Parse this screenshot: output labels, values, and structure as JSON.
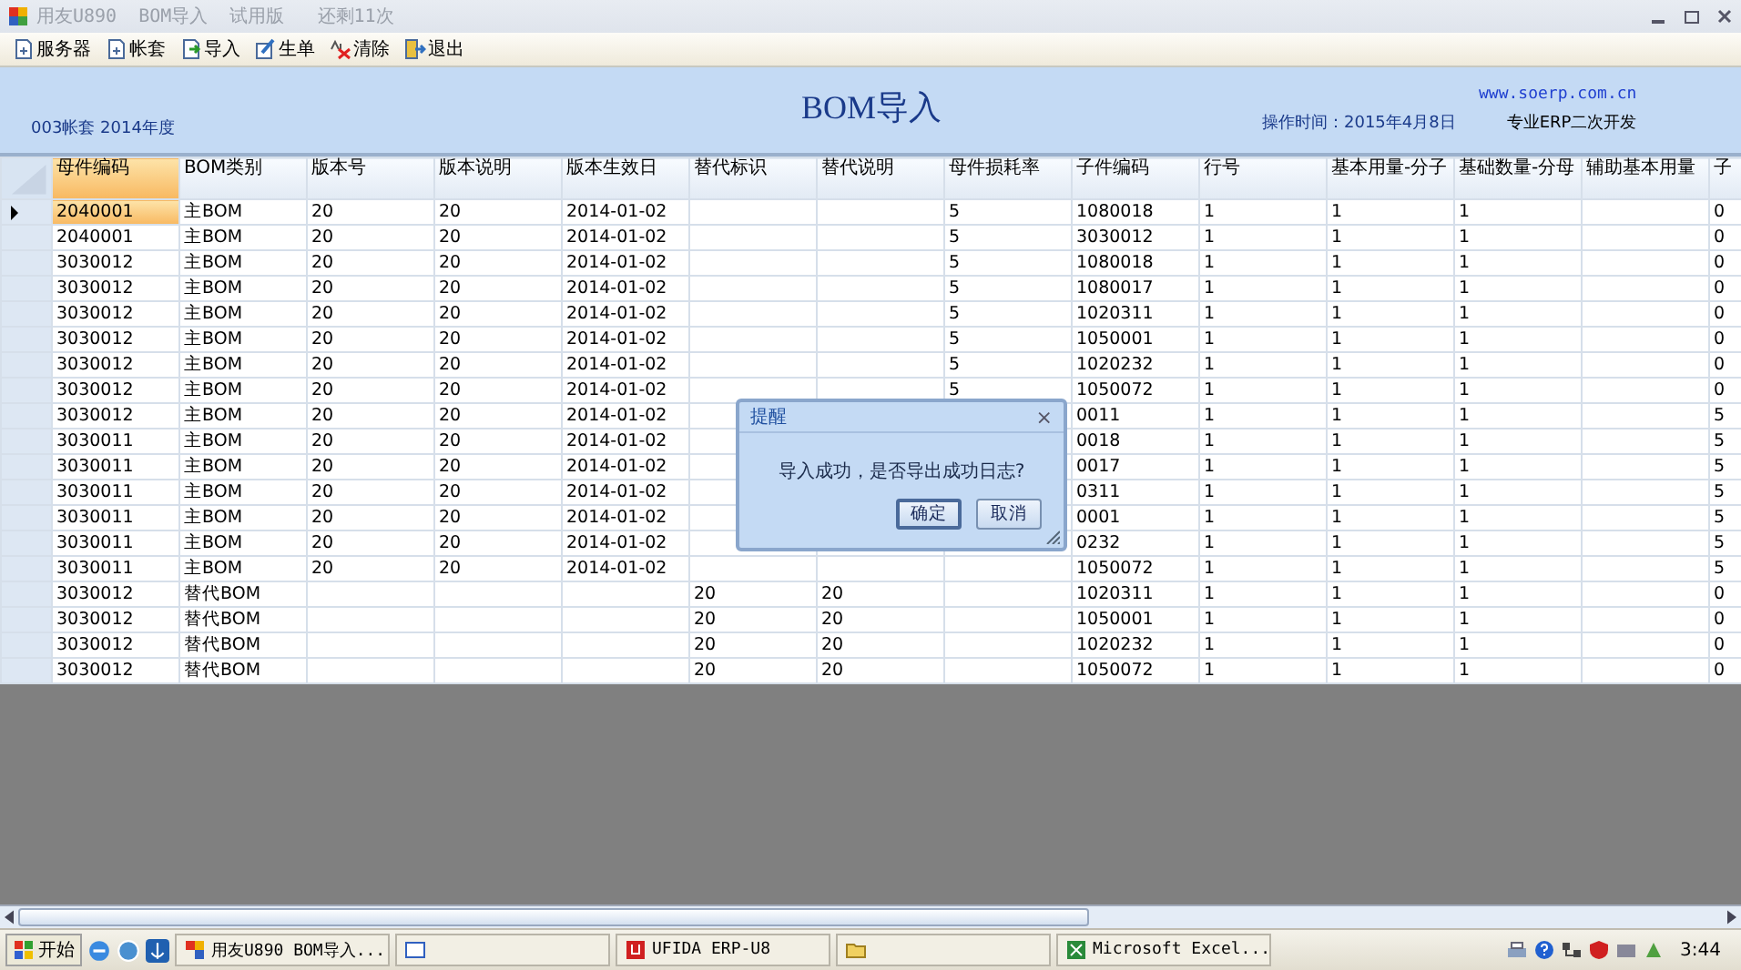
{
  "window": {
    "title": "用友U890  BOM导入  试用版   还剩11次"
  },
  "toolbar": [
    {
      "label": "服务器",
      "kind": "doc"
    },
    {
      "label": "帐套",
      "kind": "doc"
    },
    {
      "label": "导入",
      "kind": "import"
    },
    {
      "label": "生单",
      "kind": "edit"
    },
    {
      "label": "清除",
      "kind": "clear"
    },
    {
      "label": "退出",
      "kind": "exit"
    }
  ],
  "header": {
    "account": "003帐套 2014年度",
    "title": "BOM导入",
    "time": "操作时间：2015年4月8日",
    "website": "www.soerp.com.cn",
    "slogan": "专业ERP二次开发"
  },
  "table": {
    "columns": [
      {
        "label": "母件编码",
        "selected": true
      },
      {
        "label": "BOM类别",
        "selected": false
      },
      {
        "label": "版本号",
        "selected": false
      },
      {
        "label": "版本说明",
        "selected": false
      },
      {
        "label": "版本生效日",
        "selected": false
      },
      {
        "label": "替代标识",
        "selected": false
      },
      {
        "label": "替代说明",
        "selected": false
      },
      {
        "label": "母件损耗率",
        "selected": false
      },
      {
        "label": "子件编码",
        "selected": false
      },
      {
        "label": "行号",
        "selected": false
      },
      {
        "label": "基本用量-分子",
        "selected": false
      },
      {
        "label": "基础数量-分母",
        "selected": false
      },
      {
        "label": "辅助基本用量",
        "selected": false
      },
      {
        "label": "子",
        "selected": false
      }
    ],
    "rows": [
      {
        "selected": true,
        "cells": [
          "2040001",
          "主BOM",
          "20",
          "20",
          "2014-01-02",
          null,
          null,
          "5",
          "1080018",
          "1",
          "1",
          "1",
          null,
          "0"
        ]
      },
      {
        "selected": false,
        "cells": [
          "2040001",
          "主BOM",
          "20",
          "20",
          "2014-01-02",
          null,
          null,
          "5",
          "3030012",
          "1",
          "1",
          "1",
          null,
          "0"
        ]
      },
      {
        "selected": false,
        "cells": [
          "3030012",
          "主BOM",
          "20",
          "20",
          "2014-01-02",
          null,
          null,
          "5",
          "1080018",
          "1",
          "1",
          "1",
          null,
          "0"
        ]
      },
      {
        "selected": false,
        "cells": [
          "3030012",
          "主BOM",
          "20",
          "20",
          "2014-01-02",
          null,
          null,
          "5",
          "1080017",
          "1",
          "1",
          "1",
          null,
          "0"
        ]
      },
      {
        "selected": false,
        "cells": [
          "3030012",
          "主BOM",
          "20",
          "20",
          "2014-01-02",
          null,
          null,
          "5",
          "1020311",
          "1",
          "1",
          "1",
          null,
          "0"
        ]
      },
      {
        "selected": false,
        "cells": [
          "3030012",
          "主BOM",
          "20",
          "20",
          "2014-01-02",
          null,
          null,
          "5",
          "1050001",
          "1",
          "1",
          "1",
          null,
          "0"
        ]
      },
      {
        "selected": false,
        "cells": [
          "3030012",
          "主BOM",
          "20",
          "20",
          "2014-01-02",
          null,
          null,
          "5",
          "1020232",
          "1",
          "1",
          "1",
          null,
          "0"
        ]
      },
      {
        "selected": false,
        "cells": [
          "3030012",
          "主BOM",
          "20",
          "20",
          "2014-01-02",
          null,
          null,
          "5",
          "1050072",
          "1",
          "1",
          "1",
          null,
          "0"
        ]
      },
      {
        "selected": false,
        "cells": [
          "3030012",
          "主BOM",
          "20",
          "20",
          "2014-01-02",
          null,
          null,
          null,
          "0011",
          "1",
          "1",
          "1",
          null,
          "5"
        ]
      },
      {
        "selected": false,
        "cells": [
          "3030011",
          "主BOM",
          "20",
          "20",
          "2014-01-02",
          null,
          null,
          null,
          "0018",
          "1",
          "1",
          "1",
          null,
          "5"
        ]
      },
      {
        "selected": false,
        "cells": [
          "3030011",
          "主BOM",
          "20",
          "20",
          "2014-01-02",
          null,
          null,
          null,
          "0017",
          "1",
          "1",
          "1",
          null,
          "5"
        ]
      },
      {
        "selected": false,
        "cells": [
          "3030011",
          "主BOM",
          "20",
          "20",
          "2014-01-02",
          null,
          null,
          null,
          "0311",
          "1",
          "1",
          "1",
          null,
          "5"
        ]
      },
      {
        "selected": false,
        "cells": [
          "3030011",
          "主BOM",
          "20",
          "20",
          "2014-01-02",
          null,
          null,
          null,
          "0001",
          "1",
          "1",
          "1",
          null,
          "5"
        ]
      },
      {
        "selected": false,
        "cells": [
          "3030011",
          "主BOM",
          "20",
          "20",
          "2014-01-02",
          null,
          null,
          null,
          "0232",
          "1",
          "1",
          "1",
          null,
          "5"
        ]
      },
      {
        "selected": false,
        "cells": [
          "3030011",
          "主BOM",
          "20",
          "20",
          "2014-01-02",
          null,
          null,
          null,
          "1050072",
          "1",
          "1",
          "1",
          null,
          "5"
        ]
      },
      {
        "selected": false,
        "cells": [
          "3030012",
          "替代BOM",
          null,
          null,
          null,
          "20",
          "20",
          null,
          "1020311",
          "1",
          "1",
          "1",
          null,
          "0"
        ]
      },
      {
        "selected": false,
        "cells": [
          "3030012",
          "替代BOM",
          null,
          null,
          null,
          "20",
          "20",
          null,
          "1050001",
          "1",
          "1",
          "1",
          null,
          "0"
        ]
      },
      {
        "selected": false,
        "cells": [
          "3030012",
          "替代BOM",
          null,
          null,
          null,
          "20",
          "20",
          null,
          "1020232",
          "1",
          "1",
          "1",
          null,
          "0"
        ]
      },
      {
        "selected": false,
        "cells": [
          "3030012",
          "替代BOM",
          null,
          null,
          null,
          "20",
          "20",
          null,
          "1050072",
          "1",
          "1",
          "1",
          null,
          "0"
        ]
      }
    ]
  },
  "dialog": {
    "title": "提醒",
    "close": "×",
    "message": "导入成功，是否导出成功日志?",
    "buttons": [
      {
        "label": "确定",
        "selected": true
      },
      {
        "label": "取消",
        "selected": false
      }
    ]
  },
  "taskbar": {
    "start": "开始",
    "tasks": [
      {
        "label": "用友U890 BOM导入...",
        "kind": "app"
      },
      {
        "kind": "window"
      },
      {
        "label": "UFIDA ERP-U8",
        "kind": "ufida"
      },
      {
        "kind": "folder"
      },
      {
        "label": "Microsoft Excel...",
        "kind": "excel"
      }
    ],
    "clock": "3:44"
  }
}
